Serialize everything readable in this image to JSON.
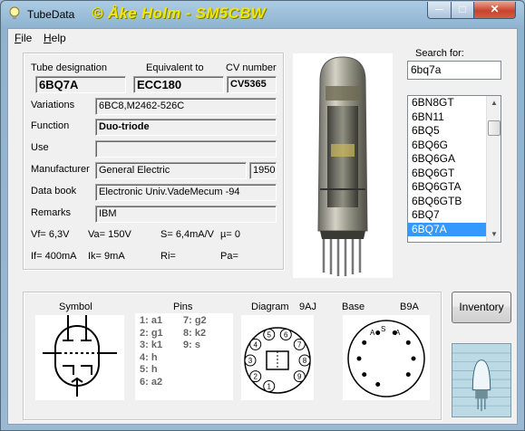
{
  "window": {
    "title": "TubeData",
    "watermark": "© Åke Holm - SM5CBW",
    "min_glyph": "─",
    "max_glyph": "□",
    "close_glyph": "✕"
  },
  "menu": {
    "file_key": "F",
    "file_rest": "ile",
    "help_key": "H",
    "help_rest": "elp"
  },
  "header_labels": {
    "designation": "Tube designation",
    "equivalent": "Equivalent to",
    "cv": "CV number"
  },
  "tube": {
    "designation": "6BQ7A",
    "equivalent": "ECC180",
    "cv": "CV5365"
  },
  "fields": {
    "variations_label": "Variations",
    "variations": "6BC8,M2462-526C",
    "function_label": "Function",
    "function": "Duo-triode",
    "use_label": "Use",
    "use": "",
    "manufacturer_label": "Manufacturer",
    "manufacturer": "General Electric",
    "year": "1950",
    "databook_label": "Data book",
    "databook": "Electronic Univ.VadeMecum -94",
    "remarks_label": "Remarks",
    "remarks": "IBM"
  },
  "specs": {
    "vf": "Vf= 6,3V",
    "va": "Va=  150V",
    "s": "S= 6,4mA/V",
    "mu": "µ=    0",
    "if": "If= 400mA",
    "ik": "Ik=   9mA",
    "ri": "Ri=",
    "pa": "Pa="
  },
  "search": {
    "label": "Search for:",
    "value": "6bq7a"
  },
  "list": {
    "items": [
      "6BN8GT",
      "6BN11",
      "6BQ5",
      "6BQ6G",
      "6BQ6GA",
      "6BQ6GT",
      "6BQ6GTA",
      "6BQ6GTB",
      "6BQ7",
      "6BQ7A"
    ],
    "selected_index": 9
  },
  "lower": {
    "symbol_label": "Symbol",
    "pins_label": "Pins",
    "diagram_label": "Diagram",
    "diagram_code": "9AJ",
    "base_label": "Base",
    "base_code": "B9A"
  },
  "pins": [
    "1: a1",
    "2: g1",
    "3: k1",
    "4: h",
    "5: h",
    "6: a2",
    "7: g2",
    "8: k2",
    "9: s"
  ],
  "diagram_pins": [
    "1",
    "2",
    "3",
    "4",
    "5",
    "6",
    "7",
    "8",
    "9"
  ],
  "base_marks": [
    "A",
    "A",
    "S"
  ],
  "inventory_label": "Inventory",
  "icons": {
    "app": "light-bulb-icon",
    "logo": "tube-logo-image"
  }
}
